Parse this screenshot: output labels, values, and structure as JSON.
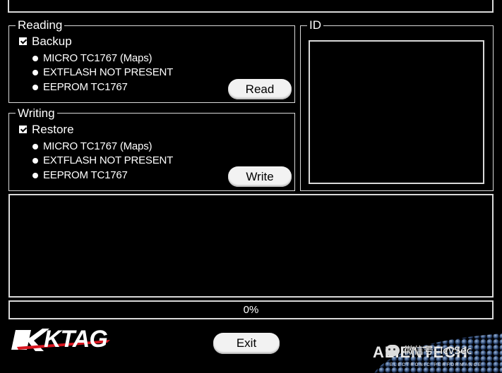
{
  "reading": {
    "title": "Reading",
    "checkbox_label": "Backup",
    "options": [
      "MICRO TC1767 (Maps)",
      "EXTFLASH NOT PRESENT",
      "EEPROM TC1767"
    ],
    "button": "Read"
  },
  "writing": {
    "title": "Writing",
    "checkbox_label": "Restore",
    "options": [
      "MICRO TC1767 (Maps)",
      "EXTFLASH NOT PRESENT",
      "EEPROM TC1767"
    ],
    "button": "Write"
  },
  "id_panel": {
    "title": "ID"
  },
  "progress": {
    "text": "0%",
    "value": 0
  },
  "exit_button": "Exit",
  "brand": {
    "ktag_logo": "KTAG",
    "alientech_logo": "ALIENTECH",
    "tagline": "ELECTRONIC PERFORMANCE",
    "watermark": "微信号: IcvSec"
  },
  "colors": {
    "border": "#d9d9d9",
    "background": "#000000",
    "accent_red": "#d7141e"
  }
}
